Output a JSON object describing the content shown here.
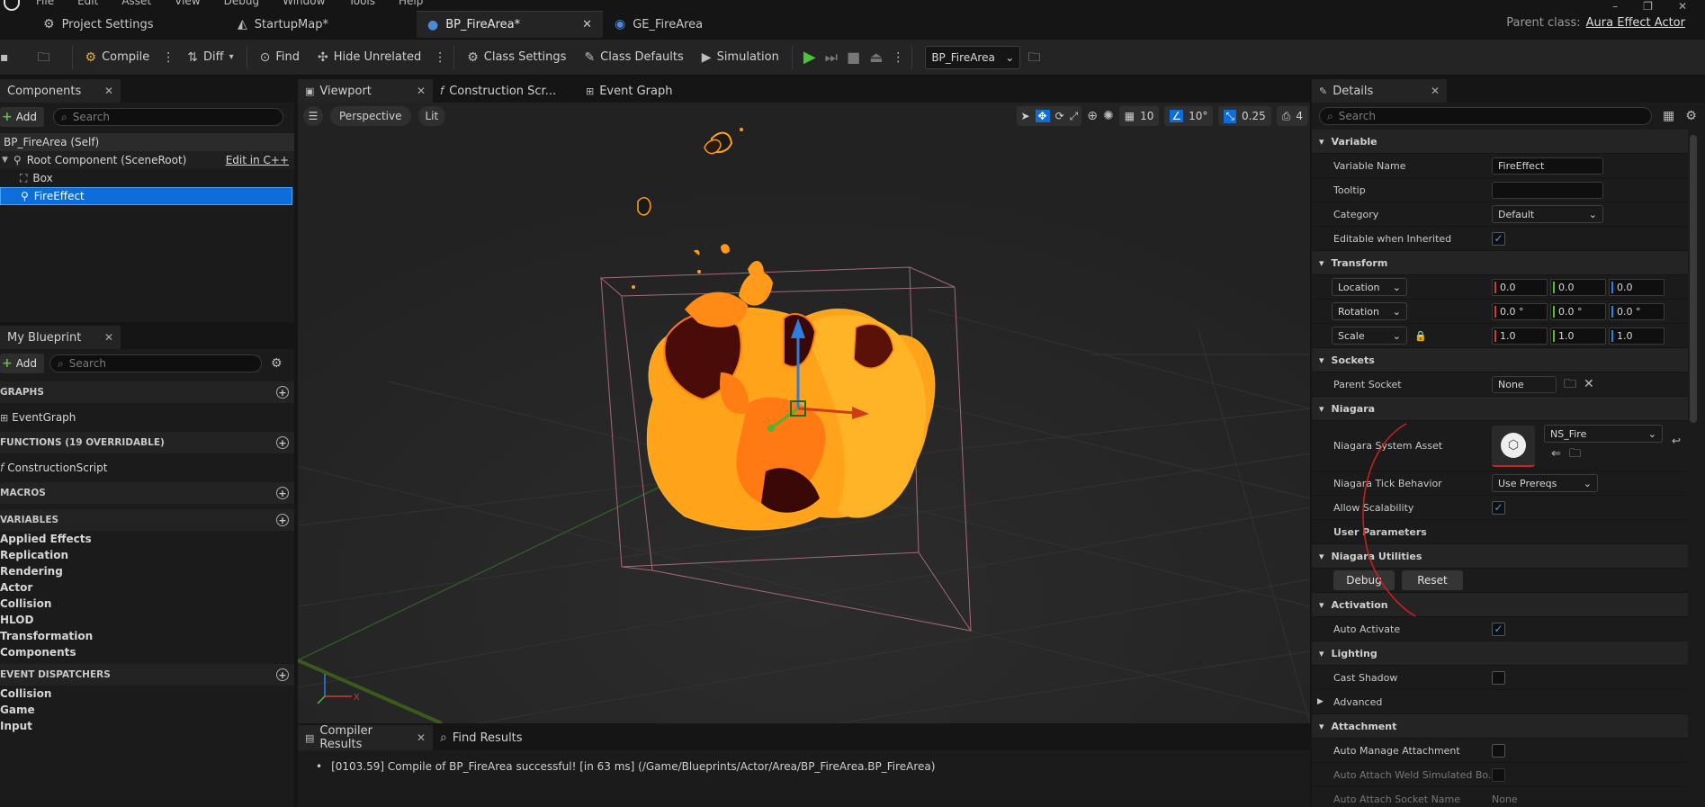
{
  "app": {
    "menu": [
      "File",
      "Edit",
      "Asset",
      "View",
      "Debug",
      "Window",
      "Tools",
      "Help"
    ],
    "tabs": [
      {
        "label": "Project Settings",
        "icon": "gear-icon"
      },
      {
        "label": "StartupMap*",
        "icon": "level-icon"
      },
      {
        "label": "BP_FireArea*",
        "icon": "blueprint-icon"
      },
      {
        "label": "GE_FireArea",
        "icon": "gameplay-effect-icon"
      }
    ],
    "parent_class_label": "Parent class:",
    "parent_class_value": "Aura Effect Actor"
  },
  "toolbar": {
    "compile": "Compile",
    "diff": "Diff",
    "find": "Find",
    "hide_unrelated": "Hide Unrelated",
    "class_settings": "Class Settings",
    "class_defaults": "Class Defaults",
    "simulation": "Simulation",
    "debug_object": "BP_FireArea"
  },
  "components": {
    "tab": "Components",
    "add": "Add",
    "search_placeholder": "Search",
    "items": [
      {
        "label": "BP_FireArea (Self)"
      },
      {
        "label": "Root Component (SceneRoot)",
        "action": "Edit in C++"
      },
      {
        "label": "Box"
      },
      {
        "label": "FireEffect"
      }
    ]
  },
  "my_blueprint": {
    "tab": "My Blueprint",
    "add": "Add",
    "search_placeholder": "Search",
    "graphs_hdr": "GRAPHS",
    "graph_item": "EventGraph",
    "functions_hdr": "FUNCTIONS (19 OVERRIDABLE)",
    "function_item": "ConstructionScript",
    "macros_hdr": "MACROS",
    "variables_hdr": "VARIABLES",
    "variable_categories": [
      "Applied Effects",
      "Replication",
      "Rendering",
      "Actor",
      "Collision",
      "HLOD",
      "Transformation",
      "Components"
    ],
    "dispatchers_hdr": "EVENT DISPATCHERS",
    "dispatcher_categories": [
      "Collision",
      "Game",
      "Input"
    ]
  },
  "editor_tabs": [
    "Viewport",
    "Construction Scr...",
    "Event Graph"
  ],
  "viewport": {
    "perspective": "Perspective",
    "lit": "Lit",
    "grid_snap": "10",
    "rot_snap": "10°",
    "scale_snap": "0.25",
    "camera_speed": "4"
  },
  "bottom": {
    "tabs": [
      "Compiler Results",
      "Find Results"
    ],
    "log": "[0103.59] Compile of BP_FireArea successful! [in 63 ms] (/Game/Blueprints/Actor/Area/BP_FireArea.BP_FireArea)"
  },
  "details": {
    "tab": "Details",
    "search_placeholder": "Search",
    "variable_hdr": "Variable",
    "variable_name_label": "Variable Name",
    "variable_name_value": "FireEffect",
    "tooltip_label": "Tooltip",
    "tooltip_value": "",
    "category_label": "Category",
    "category_value": "Default",
    "editable_label": "Editable when Inherited",
    "transform_hdr": "Transform",
    "location_label": "Location",
    "rotation_label": "Rotation",
    "scale_label": "Scale",
    "location": [
      "0.0",
      "0.0",
      "0.0"
    ],
    "rotation": [
      "0.0 °",
      "0.0 °",
      "0.0 °"
    ],
    "scale": [
      "1.0",
      "1.0",
      "1.0"
    ],
    "sockets_hdr": "Sockets",
    "parent_socket_label": "Parent Socket",
    "parent_socket_value": "None",
    "niagara_hdr": "Niagara",
    "niagara_asset_label": "Niagara System Asset",
    "niagara_asset_value": "NS_Fire",
    "tick_behavior_label": "Niagara Tick Behavior",
    "tick_behavior_value": "Use Prereqs",
    "allow_scalability_label": "Allow Scalability",
    "user_params_hdr": "User Parameters",
    "utilities_hdr": "Niagara Utilities",
    "debug_btn": "Debug",
    "reset_btn": "Reset",
    "activation_hdr": "Activation",
    "auto_activate_label": "Auto Activate",
    "lighting_hdr": "Lighting",
    "cast_shadow_label": "Cast Shadow",
    "advanced_label": "Advanced",
    "attachment_hdr": "Attachment",
    "auto_manage_label": "Auto Manage Attachment",
    "auto_weld_label": "Auto Attach Weld Simulated Bo...",
    "auto_socket_label": "Auto Attach Socket Name",
    "auto_socket_value": "None"
  }
}
